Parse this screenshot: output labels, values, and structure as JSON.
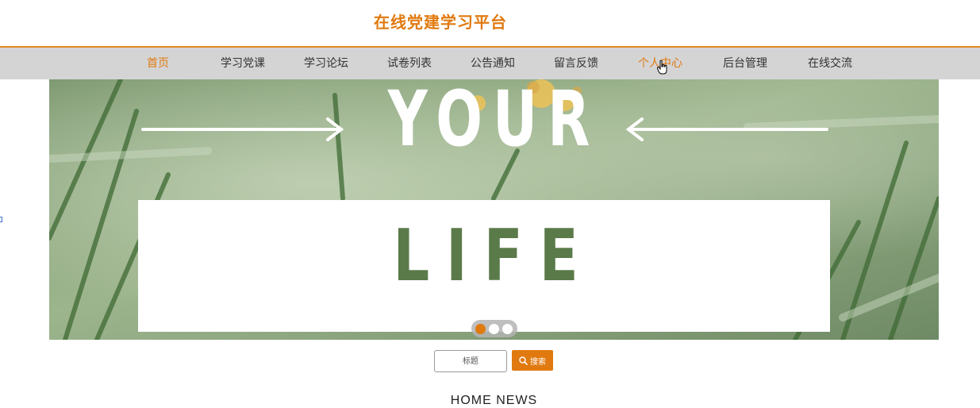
{
  "header": {
    "title": "在线党建学习平台"
  },
  "nav": {
    "items": [
      {
        "label": "首页"
      },
      {
        "label": "学习党课"
      },
      {
        "label": "学习论坛"
      },
      {
        "label": "试卷列表"
      },
      {
        "label": "公告通知"
      },
      {
        "label": "留言反馈"
      },
      {
        "label": "个人中心"
      },
      {
        "label": "后台管理"
      },
      {
        "label": "在线交流"
      }
    ],
    "active_item": "首页"
  },
  "banner": {
    "word_top": "YOUR",
    "word_bottom": "LIFE",
    "slide_count": 3,
    "active_slide": 1
  },
  "search": {
    "placeholder": "标题",
    "button_label": "搜索"
  },
  "section": {
    "title": "HOME NEWS"
  },
  "colors": {
    "accent": "#e07a10",
    "nav_bg": "#d4d4d4",
    "nav_border": "#e08a1e"
  },
  "icons": {
    "search": "search-icon",
    "cursor": "hand-cursor-icon",
    "arrow_left": "arrow-right-icon",
    "arrow_right": "arrow-left-icon"
  }
}
